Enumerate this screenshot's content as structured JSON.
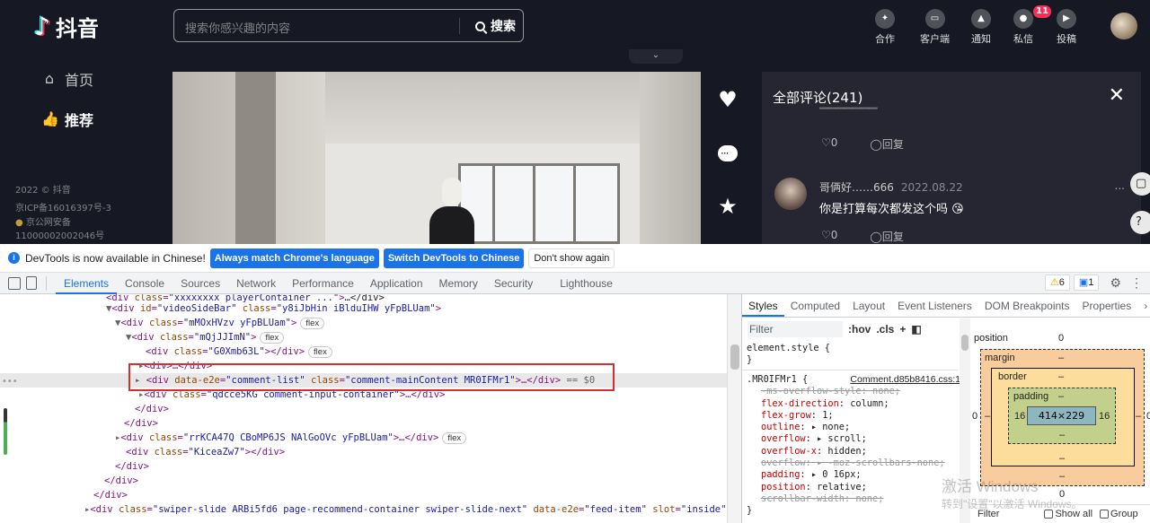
{
  "douyin": {
    "logo_text": "抖音",
    "nav": [
      {
        "label": "首页"
      },
      {
        "label": "推荐"
      }
    ],
    "footer": [
      "2022 © 抖音",
      "京ICP备16016397号-3",
      "京公网安备",
      "11000002002046号"
    ],
    "search": {
      "placeholder": "搜索你感兴趣的内容",
      "button": "搜索"
    },
    "top_icons": [
      {
        "label": "合作",
        "icon": "handshake-icon"
      },
      {
        "label": "客户端",
        "icon": "desktop-icon"
      },
      {
        "label": "通知",
        "icon": "bell-icon"
      },
      {
        "label": "私信",
        "icon": "message-icon",
        "badge": "11"
      },
      {
        "label": "投稿",
        "icon": "video-upload-icon"
      }
    ],
    "pull_icon": "chevron-down-icon",
    "comments": {
      "title": "全部评论(241)",
      "first_meta": {
        "likes": "0",
        "reply": "回复"
      },
      "comment": {
        "user": "哥俩好……666",
        "date": "2022.08.22",
        "text": "你是打算每次都发这个吗",
        "emoji": "😘",
        "likes": "0",
        "reply": "回复"
      },
      "more": "...",
      "close": "✕"
    }
  },
  "devtools": {
    "infobar": {
      "message": "DevTools is now available in Chinese!",
      "btn_match": "Always match Chrome's language",
      "btn_switch": "Switch DevTools to Chinese",
      "btn_dismiss": "Don't show again"
    },
    "tabs": [
      "Elements",
      "Console",
      "Sources",
      "Network",
      "Performance",
      "Application",
      "Memory",
      "Security",
      "Lighthouse"
    ],
    "selected_tab": "Elements",
    "warnings": "6",
    "messages": "1",
    "style_tabs": [
      "Styles",
      "Computed",
      "Layout",
      "Event Listeners",
      "DOM Breakpoints",
      "Properties"
    ],
    "filter_placeholder": "Filter",
    "hov": ":hov",
    "cls": ".cls",
    "elements": {
      "l0": {
        "cls": "xxxxxxxx playerContainer ...",
        "tail": "…</div>"
      },
      "l1": {
        "id": "videoSideBar",
        "cls": "y8iJbHin iBlduIHW yFpBLUam"
      },
      "l2": {
        "cls": "mMOxHVzv yFpBLUam",
        "badge": "flex"
      },
      "l3": {
        "cls": "mQjJJImN",
        "badge": "flex"
      },
      "l4": {
        "cls": "G0Xmb63L",
        "badge": "flex"
      },
      "l5": {
        "text": "<div>…</div>"
      },
      "l6": {
        "e2e": "comment-list",
        "cls": "comment-mainContent MR0IFMr1",
        "tail": "== $0"
      },
      "l7": {
        "cls": "qdcce5KG comment-input-container",
        "tail": "…</div>"
      },
      "l8": {
        "text": "</div>"
      },
      "l9": {
        "text": "</div>"
      },
      "l10": {
        "cls": "rrKCA47Q CBoMP6JS NAlGoOVc yFpBLUam",
        "badge": "flex"
      },
      "l11": {
        "cls": "KiceaZw7"
      },
      "l12": {
        "text": "</div>"
      },
      "l13": {
        "text": "</div>"
      },
      "l14": {
        "text": "</div>"
      },
      "l15": {
        "cls": "swiper-slide ARBi5fd6 page-recommend-container swiper-slide-next",
        "e2e": "feed-item",
        "slot": "inside"
      }
    },
    "styles": {
      "element_style": "element.style {",
      "rule_selector": ".MR0IFMr1 {",
      "rule_source": "Comment.d85b8416.css:1",
      "props": [
        {
          "name": "-ms-overflow-style",
          "value": "none;",
          "struck": true
        },
        {
          "name": "flex-direction",
          "value": "column;",
          "struck": false
        },
        {
          "name": "flex-grow",
          "value": "1;",
          "struck": false
        },
        {
          "name": "outline",
          "value": "▸ none;",
          "struck": false
        },
        {
          "name": "overflow",
          "value": "▸ scroll;",
          "struck": false
        },
        {
          "name": "overflow-x",
          "value": "hidden;",
          "struck": false
        },
        {
          "name": "overflow",
          "value": "▸ -moz-scrollbars-none;",
          "struck": true
        },
        {
          "name": "padding",
          "value": "▸ 0 16px;",
          "struck": false
        },
        {
          "name": "position",
          "value": "relative;",
          "struck": false
        },
        {
          "name": "scrollbar-width",
          "value": "none;",
          "struck": true
        }
      ]
    },
    "box_model": {
      "position_label": "position",
      "position_value": "0",
      "margin_label": "margin",
      "margin_value": "–",
      "border_label": "border",
      "border_value": "–",
      "padding_label": "padding",
      "padding_value": "–",
      "padding_left": "16",
      "padding_right": "16",
      "content": "414×229",
      "side_left": "0",
      "side_right": "0",
      "bottom_value": "0"
    },
    "filter2": {
      "label": "Filter",
      "show_all": "Show all",
      "group": "Group"
    }
  },
  "watermark": {
    "line1": "激活 Windows",
    "line2": "转到\"设置\"以激活 Windows。"
  }
}
